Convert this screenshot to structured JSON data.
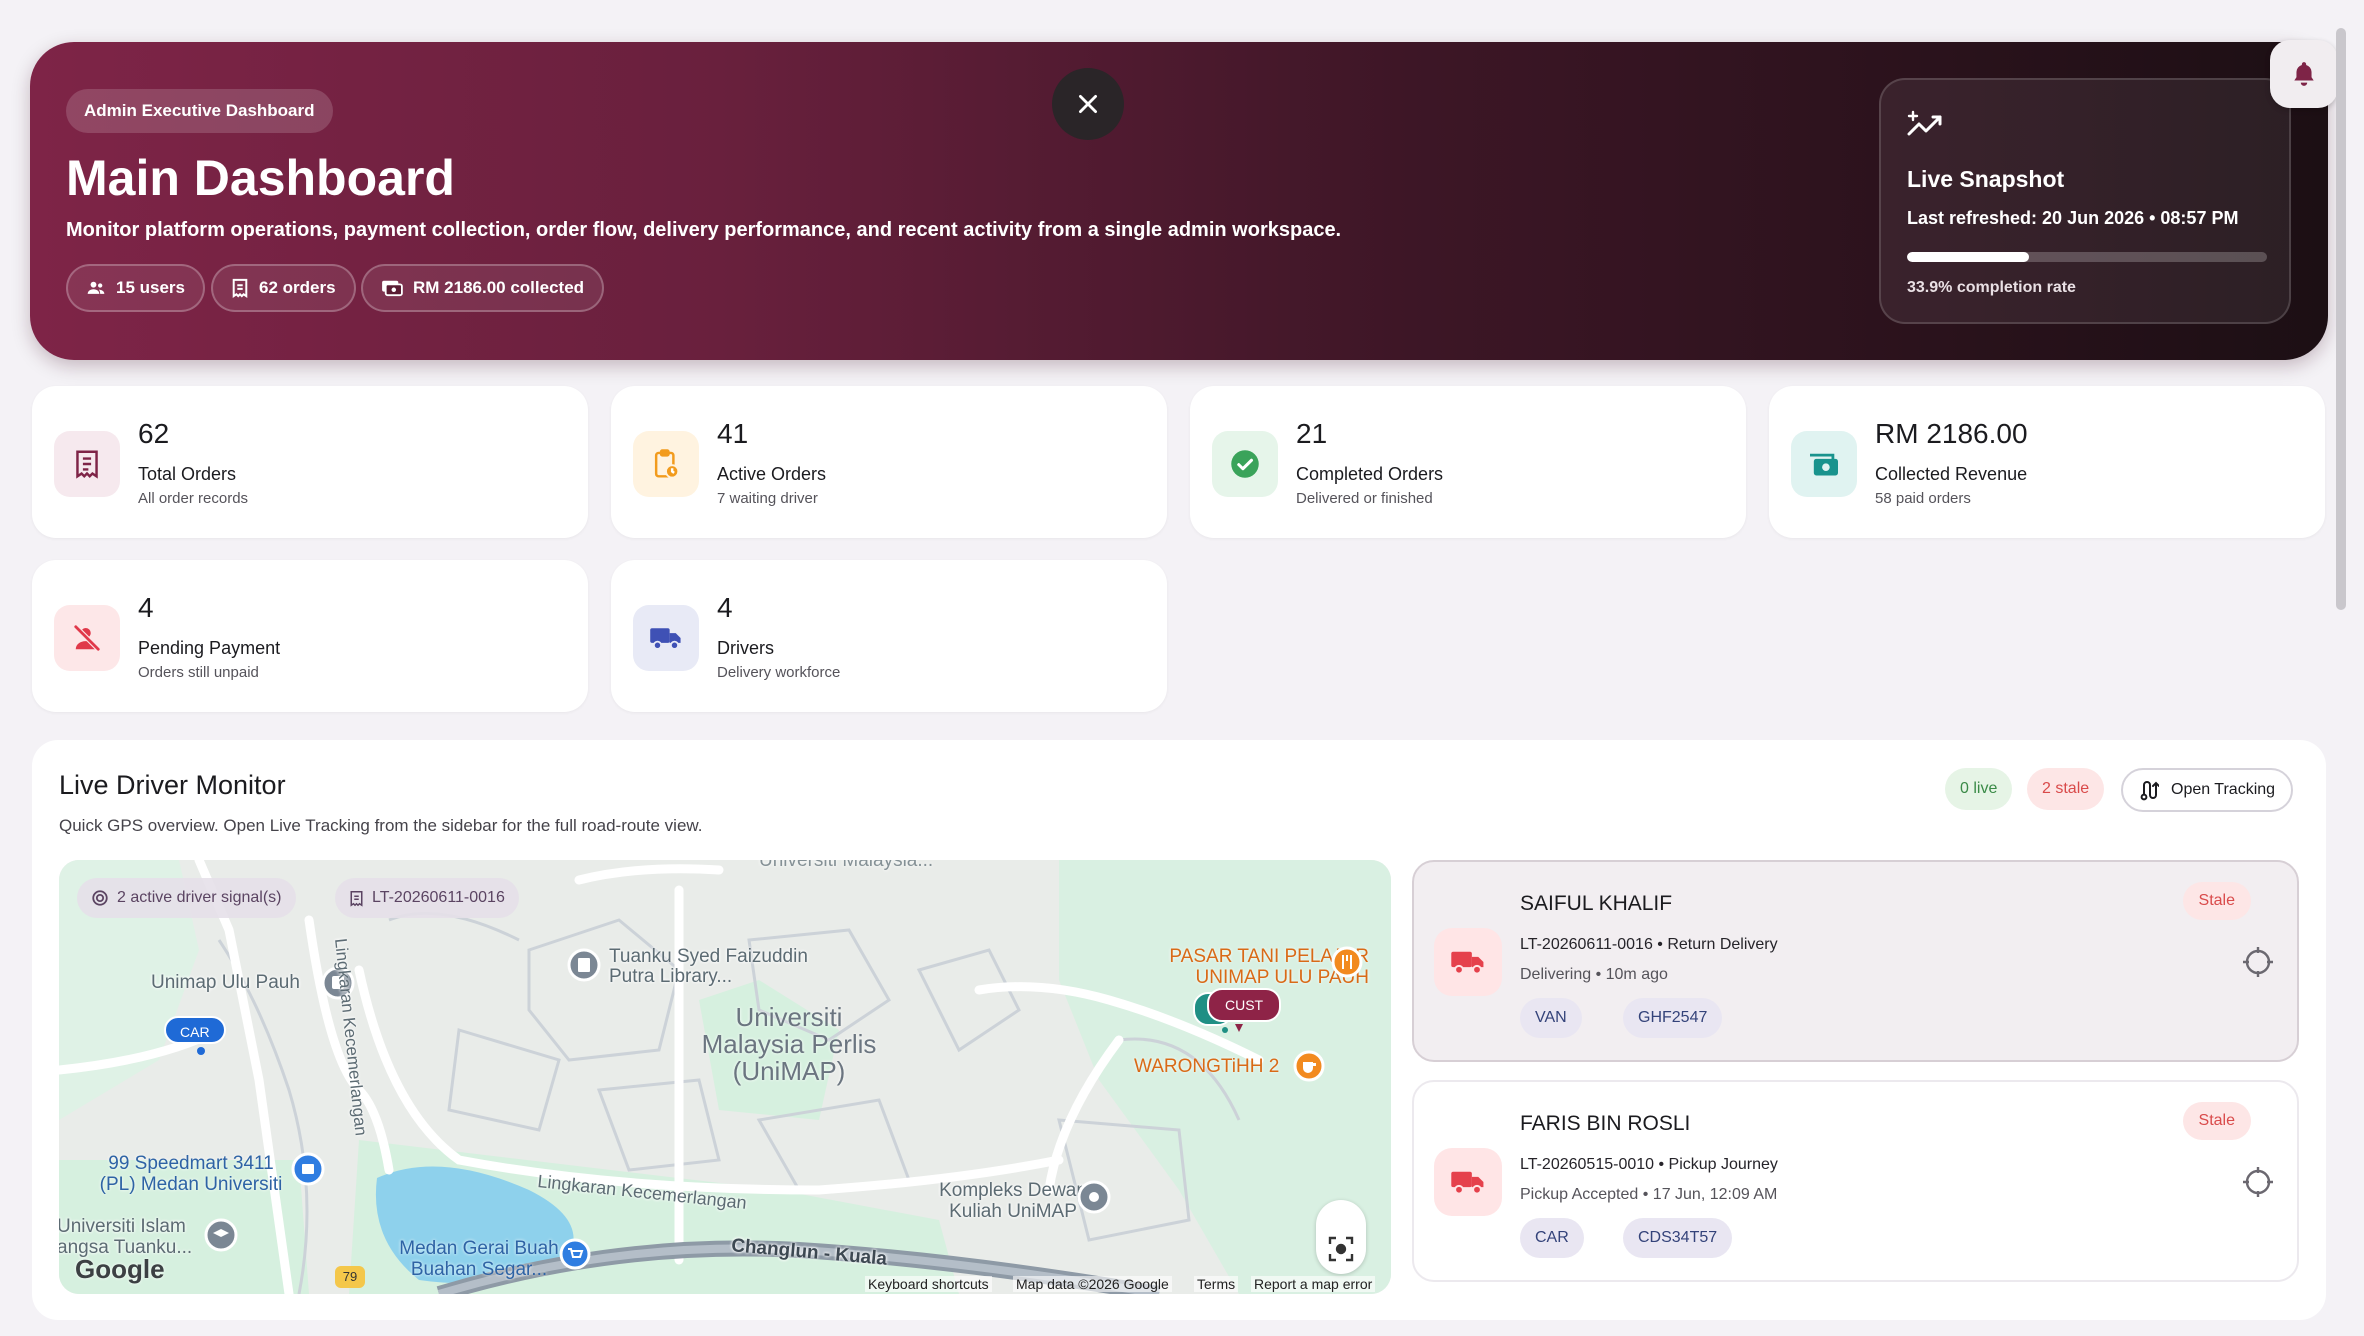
{
  "hero": {
    "badge": "Admin Executive Dashboard",
    "title": "Main Dashboard",
    "description": "Monitor platform operations, payment collection, order flow, delivery performance, and recent activity from a single admin workspace.",
    "chips": [
      {
        "label": "15 users",
        "icon": "users-icon"
      },
      {
        "label": "62 orders",
        "icon": "receipt-icon"
      },
      {
        "label": "RM 2186.00 collected",
        "icon": "cash-icon"
      }
    ],
    "snapshot": {
      "title": "Live Snapshot",
      "refreshed": "Last refreshed: 20 Jun 2026 • 08:57 PM",
      "completion_rate_label": "33.9% completion rate",
      "completion_fraction": 0.339
    }
  },
  "stats": [
    {
      "value": "62",
      "label": "Total Orders",
      "sub": "All order records",
      "icon": "receipt-icon",
      "color": "#7e2447",
      "bg": "#f6e9ee"
    },
    {
      "value": "41",
      "label": "Active Orders",
      "sub": "7 waiting driver",
      "icon": "clipboard-clock-icon",
      "color": "#f29b1d",
      "bg": "#fff3e0"
    },
    {
      "value": "21",
      "label": "Completed Orders",
      "sub": "Delivered or finished",
      "icon": "check-circle-icon",
      "color": "#3aa35a",
      "bg": "#e6f5ea"
    },
    {
      "value": "RM 2186.00",
      "label": "Collected Revenue",
      "sub": "58 paid orders",
      "icon": "cash-icon",
      "color": "#19938d",
      "bg": "#e0f3f1"
    },
    {
      "value": "4",
      "label": "Pending Payment",
      "sub": "Orders still unpaid",
      "icon": "no-payment-icon",
      "color": "#e0394a",
      "bg": "#fde7e8"
    },
    {
      "value": "4",
      "label": "Drivers",
      "sub": "Delivery workforce",
      "icon": "truck-icon",
      "color": "#3f51b5",
      "bg": "#e8eaf6"
    }
  ],
  "monitor": {
    "title": "Live Driver Monitor",
    "description": "Quick GPS overview. Open Live Tracking from the sidebar for the full road-route view.",
    "live_pill": "0 live",
    "stale_pill": "2 stale",
    "open_tracking": "Open Tracking",
    "map": {
      "signal_chip": "2 active driver signal(s)",
      "order_chip": "LT-20260611-0016",
      "labels": {
        "unimap_ulu_pauh": "Unimap Ulu Pauh",
        "library_1": "Tuanku Syed Faizuddin",
        "library_2": "Putra Library...",
        "uni_1": "Universiti",
        "uni_2": "Malaysia Perlis",
        "uni_3": "(UniMAP)",
        "lingkaran_vertical": "Lingkaran Kecemerlangan",
        "lingkaran_horizontal": "Lingkaran Kecemerlangan",
        "pasar_1": "PASAR TANI PELAJAR",
        "pasar_2": "UNIMAP ULU PAUH",
        "warong": "WARONGTiHH 2",
        "speedmart_1": "99 Speedmart 3411",
        "speedmart_2": "(PL) Medan Universiti",
        "kompleks_1": "Kompleks Dewan",
        "kompleks_2": "Kuliah UniMAP",
        "islam_1": "Universiti Islam",
        "islam_2": "angsa Tuanku...",
        "medan_1": "Medan Gerai Buah",
        "medan_2": "Buahan Segar...",
        "changlun": "Changlun - Kuala",
        "top_cut": "Universiti Malaysia..."
      },
      "route_shield": "79",
      "car_marker": "CAR",
      "cust_marker": "CUST",
      "google": "Google",
      "footer": [
        "Keyboard shortcuts",
        "Map data ©2026 Google",
        "Terms",
        "Report a map error"
      ]
    },
    "drivers": [
      {
        "name": "SAIFUL KHALIF",
        "info": "LT-20260611-0016 • Return Delivery",
        "sub": "Delivering • 10m ago",
        "vehicle": "VAN",
        "plate": "GHF2547",
        "status": "Stale"
      },
      {
        "name": "FARIS BIN ROSLI",
        "info": "LT-20260515-0010 • Pickup Journey",
        "sub": "Pickup Accepted • 17 Jun, 12:09 AM",
        "vehicle": "CAR",
        "plate": "CDS34T57",
        "status": "Stale"
      }
    ]
  }
}
